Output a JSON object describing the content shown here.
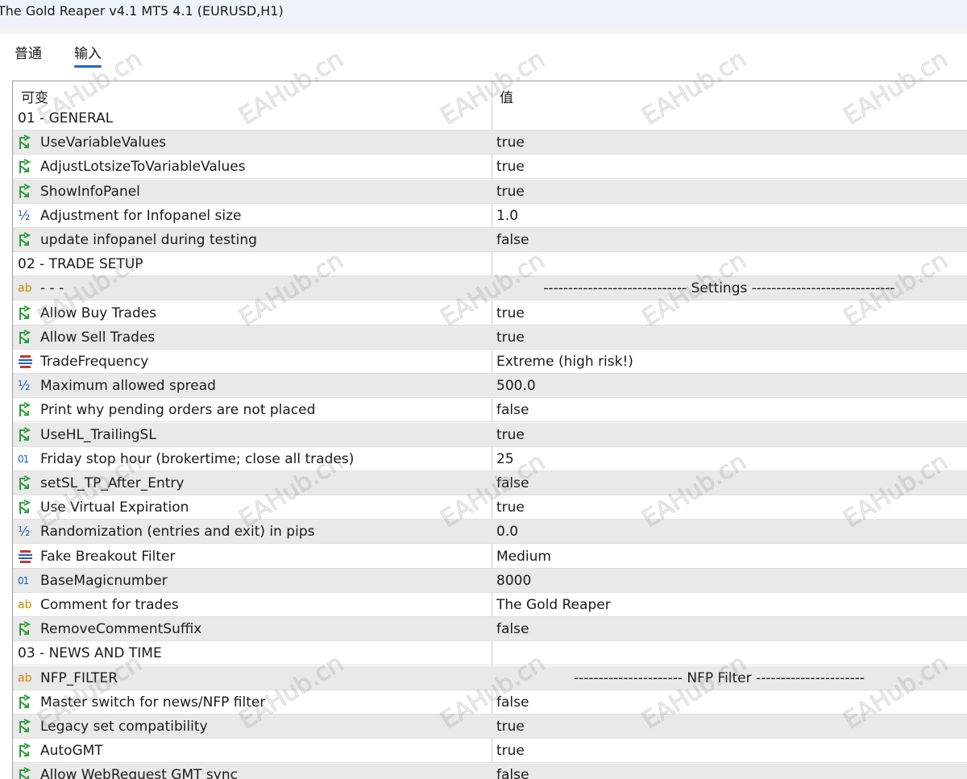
{
  "window": {
    "title": "The Gold Reaper v4.1 MT5 4.1 (EURUSD,H1)"
  },
  "tabs": [
    {
      "label": "普通",
      "active": false
    },
    {
      "label": "输入",
      "active": true
    }
  ],
  "table": {
    "headers": {
      "variable": "可变",
      "value": "值"
    },
    "rows": [
      {
        "kind": "group",
        "name": "01 - GENERAL",
        "value": ""
      },
      {
        "kind": "param",
        "icon": "bool-arrow-icon",
        "name": "UseVariableValues",
        "value": "true"
      },
      {
        "kind": "param",
        "icon": "bool-arrow-icon",
        "name": "AdjustLotsizeToVariableValues",
        "value": "true"
      },
      {
        "kind": "param",
        "icon": "bool-arrow-icon",
        "name": "ShowInfoPanel",
        "value": "true"
      },
      {
        "kind": "param",
        "icon": "double-half-icon",
        "name": "Adjustment for Infopanel size",
        "value": "1.0"
      },
      {
        "kind": "param",
        "icon": "bool-arrow-icon",
        "name": "update infopanel during testing",
        "value": "false"
      },
      {
        "kind": "group",
        "name": "02 - TRADE SETUP",
        "value": ""
      },
      {
        "kind": "param",
        "icon": "string-ab-icon",
        "name": "- - -",
        "value": "----------------------------- Settings -----------------------------",
        "centered": true
      },
      {
        "kind": "param",
        "icon": "bool-arrow-icon",
        "name": "Allow Buy Trades",
        "value": "true"
      },
      {
        "kind": "param",
        "icon": "bool-arrow-icon",
        "name": "Allow Sell Trades",
        "value": "true"
      },
      {
        "kind": "param",
        "icon": "enum-list-icon",
        "name": "TradeFrequency",
        "value": "Extreme (high risk!)"
      },
      {
        "kind": "param",
        "icon": "double-half-icon",
        "name": "Maximum allowed spread",
        "value": "500.0"
      },
      {
        "kind": "param",
        "icon": "bool-arrow-icon",
        "name": "Print why pending orders are not placed",
        "value": "false"
      },
      {
        "kind": "param",
        "icon": "bool-arrow-icon",
        "name": "UseHL_TrailingSL",
        "value": "true"
      },
      {
        "kind": "param",
        "icon": "integer-01-icon",
        "name": "Friday stop hour (brokertime; close all trades)",
        "value": "25"
      },
      {
        "kind": "param",
        "icon": "bool-arrow-icon",
        "name": "setSL_TP_After_Entry",
        "value": "false"
      },
      {
        "kind": "param",
        "icon": "bool-arrow-icon",
        "name": "Use Virtual Expiration",
        "value": "true"
      },
      {
        "kind": "param",
        "icon": "double-half-icon",
        "name": "Randomization (entries and exit) in pips",
        "value": "0.0"
      },
      {
        "kind": "param",
        "icon": "enum-list-icon",
        "name": "Fake Breakout Filter",
        "value": "Medium"
      },
      {
        "kind": "param",
        "icon": "integer-01-icon",
        "name": "BaseMagicnumber",
        "value": "8000"
      },
      {
        "kind": "param",
        "icon": "string-ab-icon",
        "name": "Comment for trades",
        "value": "The Gold Reaper"
      },
      {
        "kind": "param",
        "icon": "bool-arrow-icon",
        "name": "RemoveCommentSuffix",
        "value": "false"
      },
      {
        "kind": "group",
        "name": "03 - NEWS AND TIME",
        "value": ""
      },
      {
        "kind": "param",
        "icon": "string-ab-icon",
        "name": "NFP_FILTER",
        "value": "---------------------- NFP Filter ----------------------",
        "centered": true
      },
      {
        "kind": "param",
        "icon": "bool-arrow-icon",
        "name": "Master switch for news/NFP filter",
        "value": "false"
      },
      {
        "kind": "param",
        "icon": "bool-arrow-icon",
        "name": "Legacy set compatibility",
        "value": "true"
      },
      {
        "kind": "param",
        "icon": "bool-arrow-icon",
        "name": "AutoGMT",
        "value": "true"
      },
      {
        "kind": "param",
        "icon": "bool-arrow-icon",
        "name": "Allow WebRequest GMT sync",
        "value": "false"
      }
    ]
  },
  "watermark": {
    "text": "EAHub.cn"
  },
  "colors": {
    "bool_icon": "#2e9e3a",
    "numeric_icon": "#1f5fbf",
    "string_icon": "#cc8a00",
    "enum_icon": "#c0392b",
    "tab_underline": "#1f66c7",
    "shaded_row": "#e9e9e9"
  }
}
